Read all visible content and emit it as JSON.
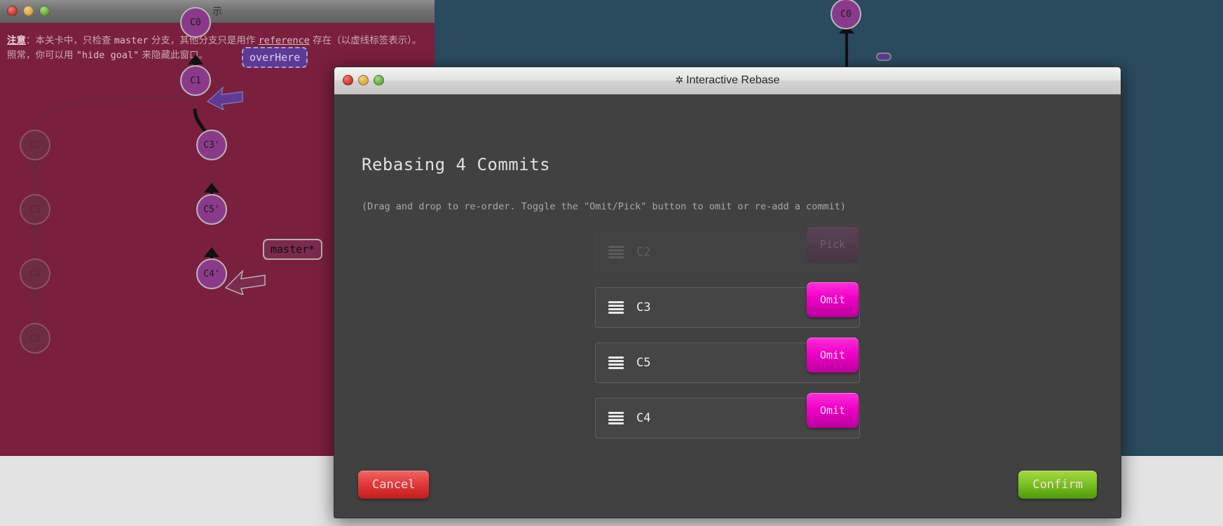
{
  "goal_window": {
    "title": "示",
    "note": {
      "prefix_bold": "注意",
      "colon": "：",
      "part1": "本关卡中，只检查 ",
      "mono1": "master",
      "part2": " 分支，其他分支只是用作 ",
      "mono2": "reference",
      "part3": " 存在（以虚线标签表示）。照常，你可以用 ",
      "mono3": "\"hide goal\"",
      "part4": " 来隐藏此窗口。",
      "full_text": "注意：本关卡中，只检查 master 分支，其他分支只是用作 reference 存在（以虚线标签表示）。照常，你可以用 \"hide goal\" 来隐藏此窗口。"
    },
    "nodes": [
      {
        "label": "C0",
        "state": "bright"
      },
      {
        "label": "C1",
        "state": "bright"
      },
      {
        "label": "C2",
        "state": "faded"
      },
      {
        "label": "C3",
        "state": "faded"
      },
      {
        "label": "C4",
        "state": "faded"
      },
      {
        "label": "C5",
        "state": "faded"
      },
      {
        "label": "C3'",
        "state": "bright"
      },
      {
        "label": "C5'",
        "state": "bright"
      },
      {
        "label": "C4'",
        "state": "bright"
      }
    ],
    "tags": [
      {
        "label": "overHere",
        "style": "dashed"
      },
      {
        "label": "master*",
        "style": "solid"
      }
    ]
  },
  "tree_window": {
    "nodes": [
      {
        "label": "C0"
      }
    ]
  },
  "modal": {
    "title": "Interactive Rebase",
    "gear_icon": "gear-icon",
    "heading": "Rebasing 4 Commits",
    "subtitle": "(Drag and drop to re-order. Toggle the \"Omit/Pick\" button to omit or re-add a commit)",
    "commits": [
      {
        "name": "C2",
        "action_label": "Pick",
        "omitted": true
      },
      {
        "name": "C3",
        "action_label": "Omit",
        "omitted": false
      },
      {
        "name": "C5",
        "action_label": "Omit",
        "omitted": false
      },
      {
        "name": "C4",
        "action_label": "Omit",
        "omitted": false
      }
    ],
    "cancel_label": "Cancel",
    "confirm_label": "Confirm"
  },
  "colors": {
    "goal_bg": "#7a1f3d",
    "tree_bg": "#2a4a5e",
    "modal_bg": "#414141",
    "omit_button": "#f000c6",
    "confirm_button": "#7cc423",
    "cancel_button": "#e23b3b",
    "commit_node": "#8b3a8b"
  }
}
